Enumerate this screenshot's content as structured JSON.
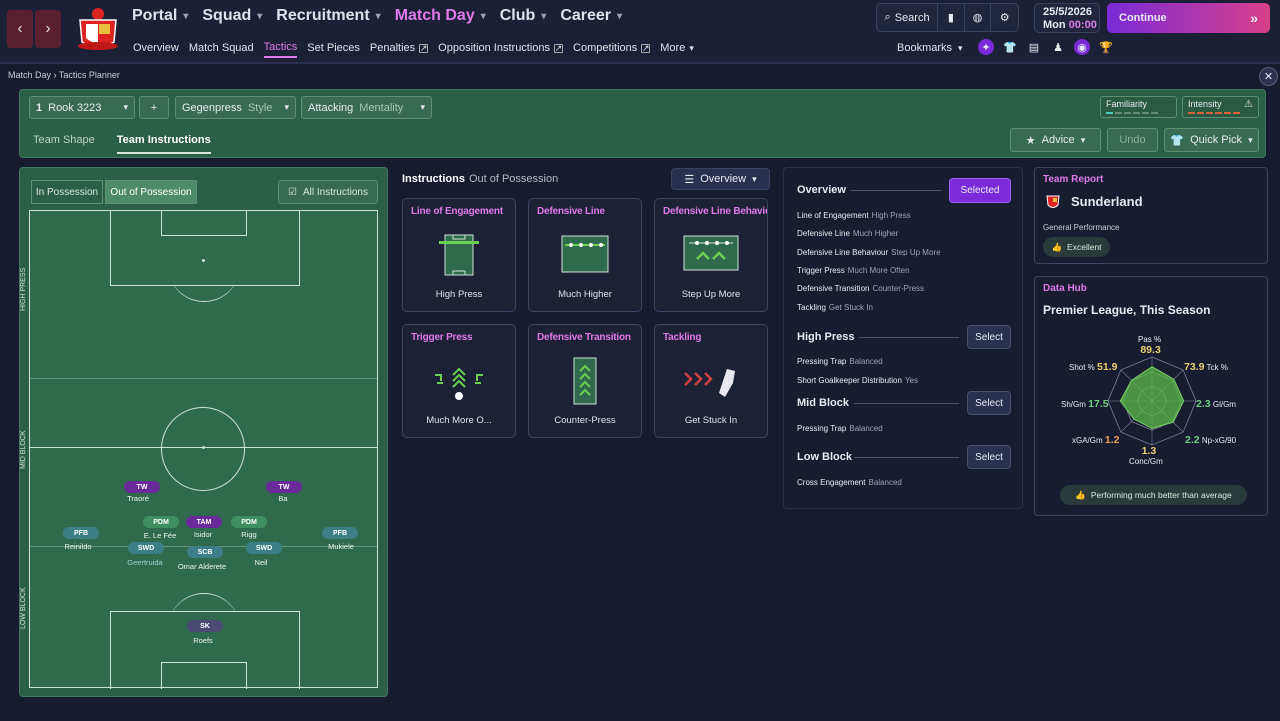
{
  "nav": {
    "back": "‹",
    "forward": "›"
  },
  "menu": [
    {
      "label": "Portal",
      "active": false
    },
    {
      "label": "Squad",
      "active": false
    },
    {
      "label": "Recruitment",
      "active": false
    },
    {
      "label": "Match Day",
      "active": true
    },
    {
      "label": "Club",
      "active": false
    },
    {
      "label": "Career",
      "active": false
    }
  ],
  "submenu": {
    "overview": "Overview",
    "match_squad": "Match Squad",
    "tactics": "Tactics",
    "set_pieces": "Set Pieces",
    "penalties": "Penalties",
    "opposition": "Opposition Instructions",
    "competitions": "Competitions",
    "more": "More"
  },
  "toolbar": {
    "search": "Search"
  },
  "date": {
    "date": "25/5/2026",
    "day": "Mon",
    "time": "00:00"
  },
  "continue": "Continue",
  "bookmarks": "Bookmarks",
  "breadcrumb": {
    "a": "Match Day",
    "b": "Tactics Planner"
  },
  "planner": {
    "tactic_num": "1",
    "tactic_name": "Rook 3223",
    "add": "+",
    "style_value": "Gegenpress",
    "style_label": "Style",
    "mentality_value": "Attacking",
    "mentality_label": "Mentality",
    "familiarity": "Familiarity",
    "intensity": "Intensity",
    "tabs": [
      "Team Shape",
      "Team Instructions"
    ],
    "advice": "Advice",
    "undo": "Undo",
    "quick_pick": "Quick Pick"
  },
  "pitch": {
    "in_possession": "In Possession",
    "out_possession": "Out of Possession",
    "all_instructions": "All Instructions",
    "zones": {
      "high": "HIGH PRESS",
      "mid": "MID BLOCK",
      "low": "LOW BLOCK"
    },
    "players": [
      {
        "role": "TW",
        "name": "Traoré",
        "cls": "tw"
      },
      {
        "role": "TW",
        "name": "Ba",
        "cls": "tw"
      },
      {
        "role": "PDM",
        "name": "E. Le Fée",
        "cls": "pdm"
      },
      {
        "role": "TAM",
        "name": "Isidor",
        "cls": "tam"
      },
      {
        "role": "PDM",
        "name": "Rigg",
        "cls": "pdm"
      },
      {
        "role": "PFB",
        "name": "Reinildo",
        "cls": "pfb"
      },
      {
        "role": "SWD",
        "name": "Geertruida",
        "cls": "swd"
      },
      {
        "role": "SCB",
        "name": "Omar Alderete",
        "cls": "scb"
      },
      {
        "role": "SWD",
        "name": "Neil",
        "cls": "swd"
      },
      {
        "role": "PFB",
        "name": "Mukiele",
        "cls": "pfb"
      },
      {
        "role": "SK",
        "name": "Roefs",
        "cls": "sk"
      }
    ]
  },
  "instructions": {
    "title": "Instructions",
    "subtitle": "Out of Possession",
    "dropdown": "Overview",
    "cards": [
      {
        "title": "Line of Engagement",
        "value": "High Press"
      },
      {
        "title": "Defensive Line",
        "value": "Much Higher"
      },
      {
        "title": "Defensive Line Behavic",
        "value": "Step Up More"
      },
      {
        "title": "Trigger Press",
        "value": "Much More O..."
      },
      {
        "title": "Defensive Transition",
        "value": "Counter-Press"
      },
      {
        "title": "Tackling",
        "value": "Get Stuck In"
      }
    ]
  },
  "overview": {
    "title": "Overview",
    "selected": "Selected",
    "rows": [
      {
        "k": "Line of Engagement",
        "v": "High Press"
      },
      {
        "k": "Defensive Line",
        "v": "Much Higher"
      },
      {
        "k": "Defensive Line Behaviour",
        "v": "Step Up More"
      },
      {
        "k": "Trigger Press",
        "v": "Much More Often"
      },
      {
        "k": "Defensive Transition",
        "v": "Counter-Press"
      },
      {
        "k": "Tackling",
        "v": "Get Stuck In"
      }
    ],
    "high_press": {
      "title": "High Press",
      "btn": "Select",
      "rows": [
        {
          "k": "Pressing Trap",
          "v": "Balanced"
        },
        {
          "k": "Short Goalkeeper Distribution",
          "v": "Yes"
        }
      ]
    },
    "mid_block": {
      "title": "Mid Block",
      "btn": "Select",
      "rows": [
        {
          "k": "Pressing Trap",
          "v": "Balanced"
        }
      ]
    },
    "low_block": {
      "title": "Low Block",
      "btn": "Select",
      "rows": [
        {
          "k": "Cross Engagement",
          "v": "Balanced"
        }
      ]
    }
  },
  "team_report": {
    "title": "Team Report",
    "team": "Sunderland",
    "label": "General Performance",
    "badge": "Excellent"
  },
  "data_hub": {
    "title": "Data Hub",
    "subtitle": "Premier League, This Season",
    "metrics": [
      {
        "label": "Pas %",
        "value": "89.3"
      },
      {
        "label": "Tck %",
        "value": "73.9"
      },
      {
        "label": "Gl/Gm",
        "value": "2.3"
      },
      {
        "label": "Np-xG/90",
        "value": "2.2"
      },
      {
        "label": "Conc/Gm",
        "value": "1.3"
      },
      {
        "label": "xGA/Gm",
        "value": "1.2"
      },
      {
        "label": "Sh/Gm",
        "value": "17.5"
      },
      {
        "label": "Shot %",
        "value": "51.9"
      }
    ],
    "radar_levels": [
      0.78,
      0.7,
      0.72,
      0.68,
      0.62,
      0.58,
      0.72,
      0.66
    ],
    "footer": "Performing much better than average"
  },
  "colors": {
    "accent": "#e07ae8",
    "purple": "#7a2ad8",
    "pitch": "#2f6a4d"
  }
}
